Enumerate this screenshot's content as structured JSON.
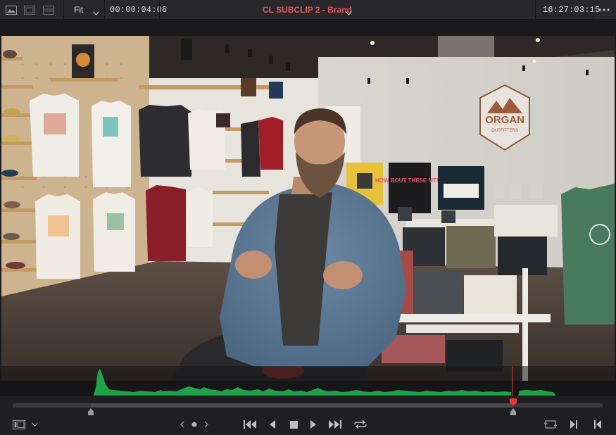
{
  "toolbar": {
    "zoom_label": "Fit",
    "source_timecode": "00:00:04:08",
    "clip_name": "CL SUBCLIP 2 - Brand",
    "record_timecode": "16:27:03:15"
  },
  "scene": {
    "store_logo_word": "ORGAN",
    "store_logo_sub": "OUTFITTERS",
    "sign_text": "HOW BOUT THESE MTNS"
  },
  "colors": {
    "accent_red": "#e0585f",
    "waveform_green": "#1fa24a",
    "playhead_red": "#e23a3a"
  },
  "playback": {
    "playhead_fraction": 0.846
  }
}
